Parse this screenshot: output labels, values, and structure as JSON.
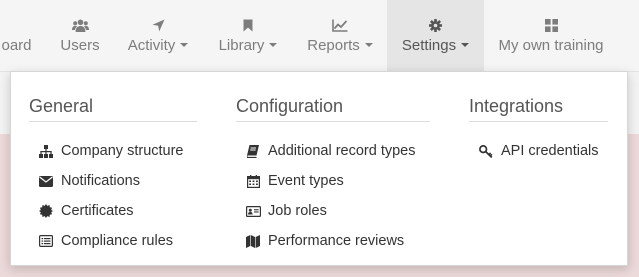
{
  "navbar": {
    "items": [
      {
        "label": "oard",
        "icon": "dashboard-icon",
        "has_caret": false
      },
      {
        "label": "Users",
        "icon": "users-icon",
        "has_caret": false
      },
      {
        "label": "Activity",
        "icon": "location-arrow-icon",
        "has_caret": true
      },
      {
        "label": "Library",
        "icon": "bookmark-icon",
        "has_caret": true
      },
      {
        "label": "Reports",
        "icon": "line-chart-icon",
        "has_caret": true
      },
      {
        "label": "Settings",
        "icon": "gear-icon",
        "has_caret": true,
        "active": true
      },
      {
        "label": "My own training",
        "icon": "grid-icon",
        "has_caret": false
      }
    ]
  },
  "settings_menu": {
    "general": {
      "title": "General",
      "items": [
        {
          "label": "Company structure",
          "icon": "sitemap-icon"
        },
        {
          "label": "Notifications",
          "icon": "envelope-icon"
        },
        {
          "label": "Certificates",
          "icon": "certificate-icon"
        },
        {
          "label": "Compliance rules",
          "icon": "list-alt-icon"
        }
      ]
    },
    "configuration": {
      "title": "Configuration",
      "items": [
        {
          "label": "Additional record types",
          "icon": "book-icon"
        },
        {
          "label": "Event types",
          "icon": "calendar-icon"
        },
        {
          "label": "Job roles",
          "icon": "id-card-icon"
        },
        {
          "label": "Performance reviews",
          "icon": "map-icon"
        }
      ]
    },
    "integrations": {
      "title": "Integrations",
      "items": [
        {
          "label": "API credentials",
          "icon": "key-icon"
        }
      ]
    }
  },
  "colors": {
    "nav_text": "#7d7d7d",
    "active_tab_bg": "#e5e5e5",
    "menu_text": "#333333",
    "alert_bg": "#ecd9d9"
  }
}
